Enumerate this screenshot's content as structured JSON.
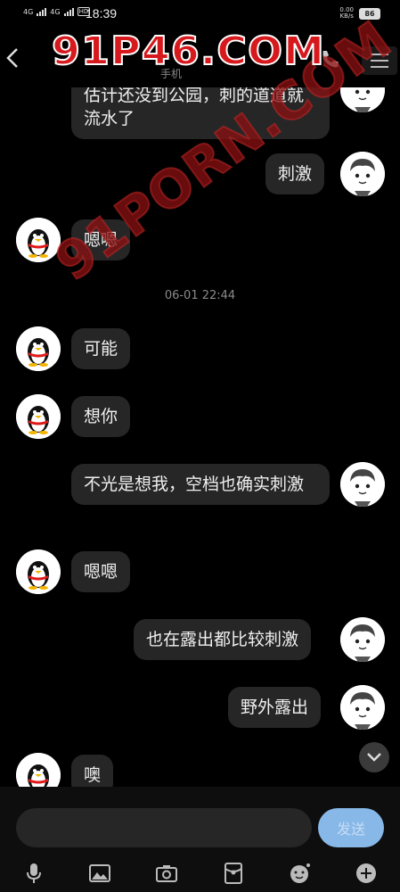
{
  "status_bar": {
    "network1": "4G",
    "network2": "4G",
    "hd": "HD",
    "time": "18:39",
    "speed_value": "0.00",
    "speed_unit": "KB/s",
    "battery": "86"
  },
  "header": {
    "subtitle": "手机"
  },
  "watermarks": {
    "top": "91P46.COM",
    "diagonal": "91PORN.COM"
  },
  "messages": [
    {
      "side": "right",
      "text": "估计还没到公园，刺的道道就流水了",
      "avatar": "cartoon-boy-avatar"
    },
    {
      "side": "right",
      "text": "刺激",
      "avatar": "cartoon-boy-avatar"
    },
    {
      "side": "left",
      "text": "嗯嗯",
      "avatar": "qq-penguin-avatar"
    },
    {
      "side": "left",
      "text": "可能",
      "avatar": "qq-penguin-avatar"
    },
    {
      "side": "left",
      "text": "想你",
      "avatar": "qq-penguin-avatar"
    },
    {
      "side": "right",
      "text": "不光是想我，空档也确实刺激",
      "avatar": "cartoon-boy-avatar"
    },
    {
      "side": "left",
      "text": "嗯嗯",
      "avatar": "qq-penguin-avatar"
    },
    {
      "side": "right",
      "text": "也在露出都比较刺激",
      "avatar": "cartoon-boy-avatar"
    },
    {
      "side": "right",
      "text": "野外露出",
      "avatar": "cartoon-boy-avatar"
    },
    {
      "side": "left",
      "text": "噢",
      "avatar": "qq-penguin-avatar"
    }
  ],
  "timestamp": "06-01 22:44",
  "input": {
    "placeholder": "",
    "send_label": "发送"
  },
  "toolbar": [
    "voice-icon",
    "image-icon",
    "camera-icon",
    "red-packet-icon",
    "emoji-icon",
    "plus-icon"
  ],
  "colors": {
    "background": "#000000",
    "bubble": "#262626",
    "send_button": "#87b8e8",
    "watermark": "#d6191d"
  }
}
